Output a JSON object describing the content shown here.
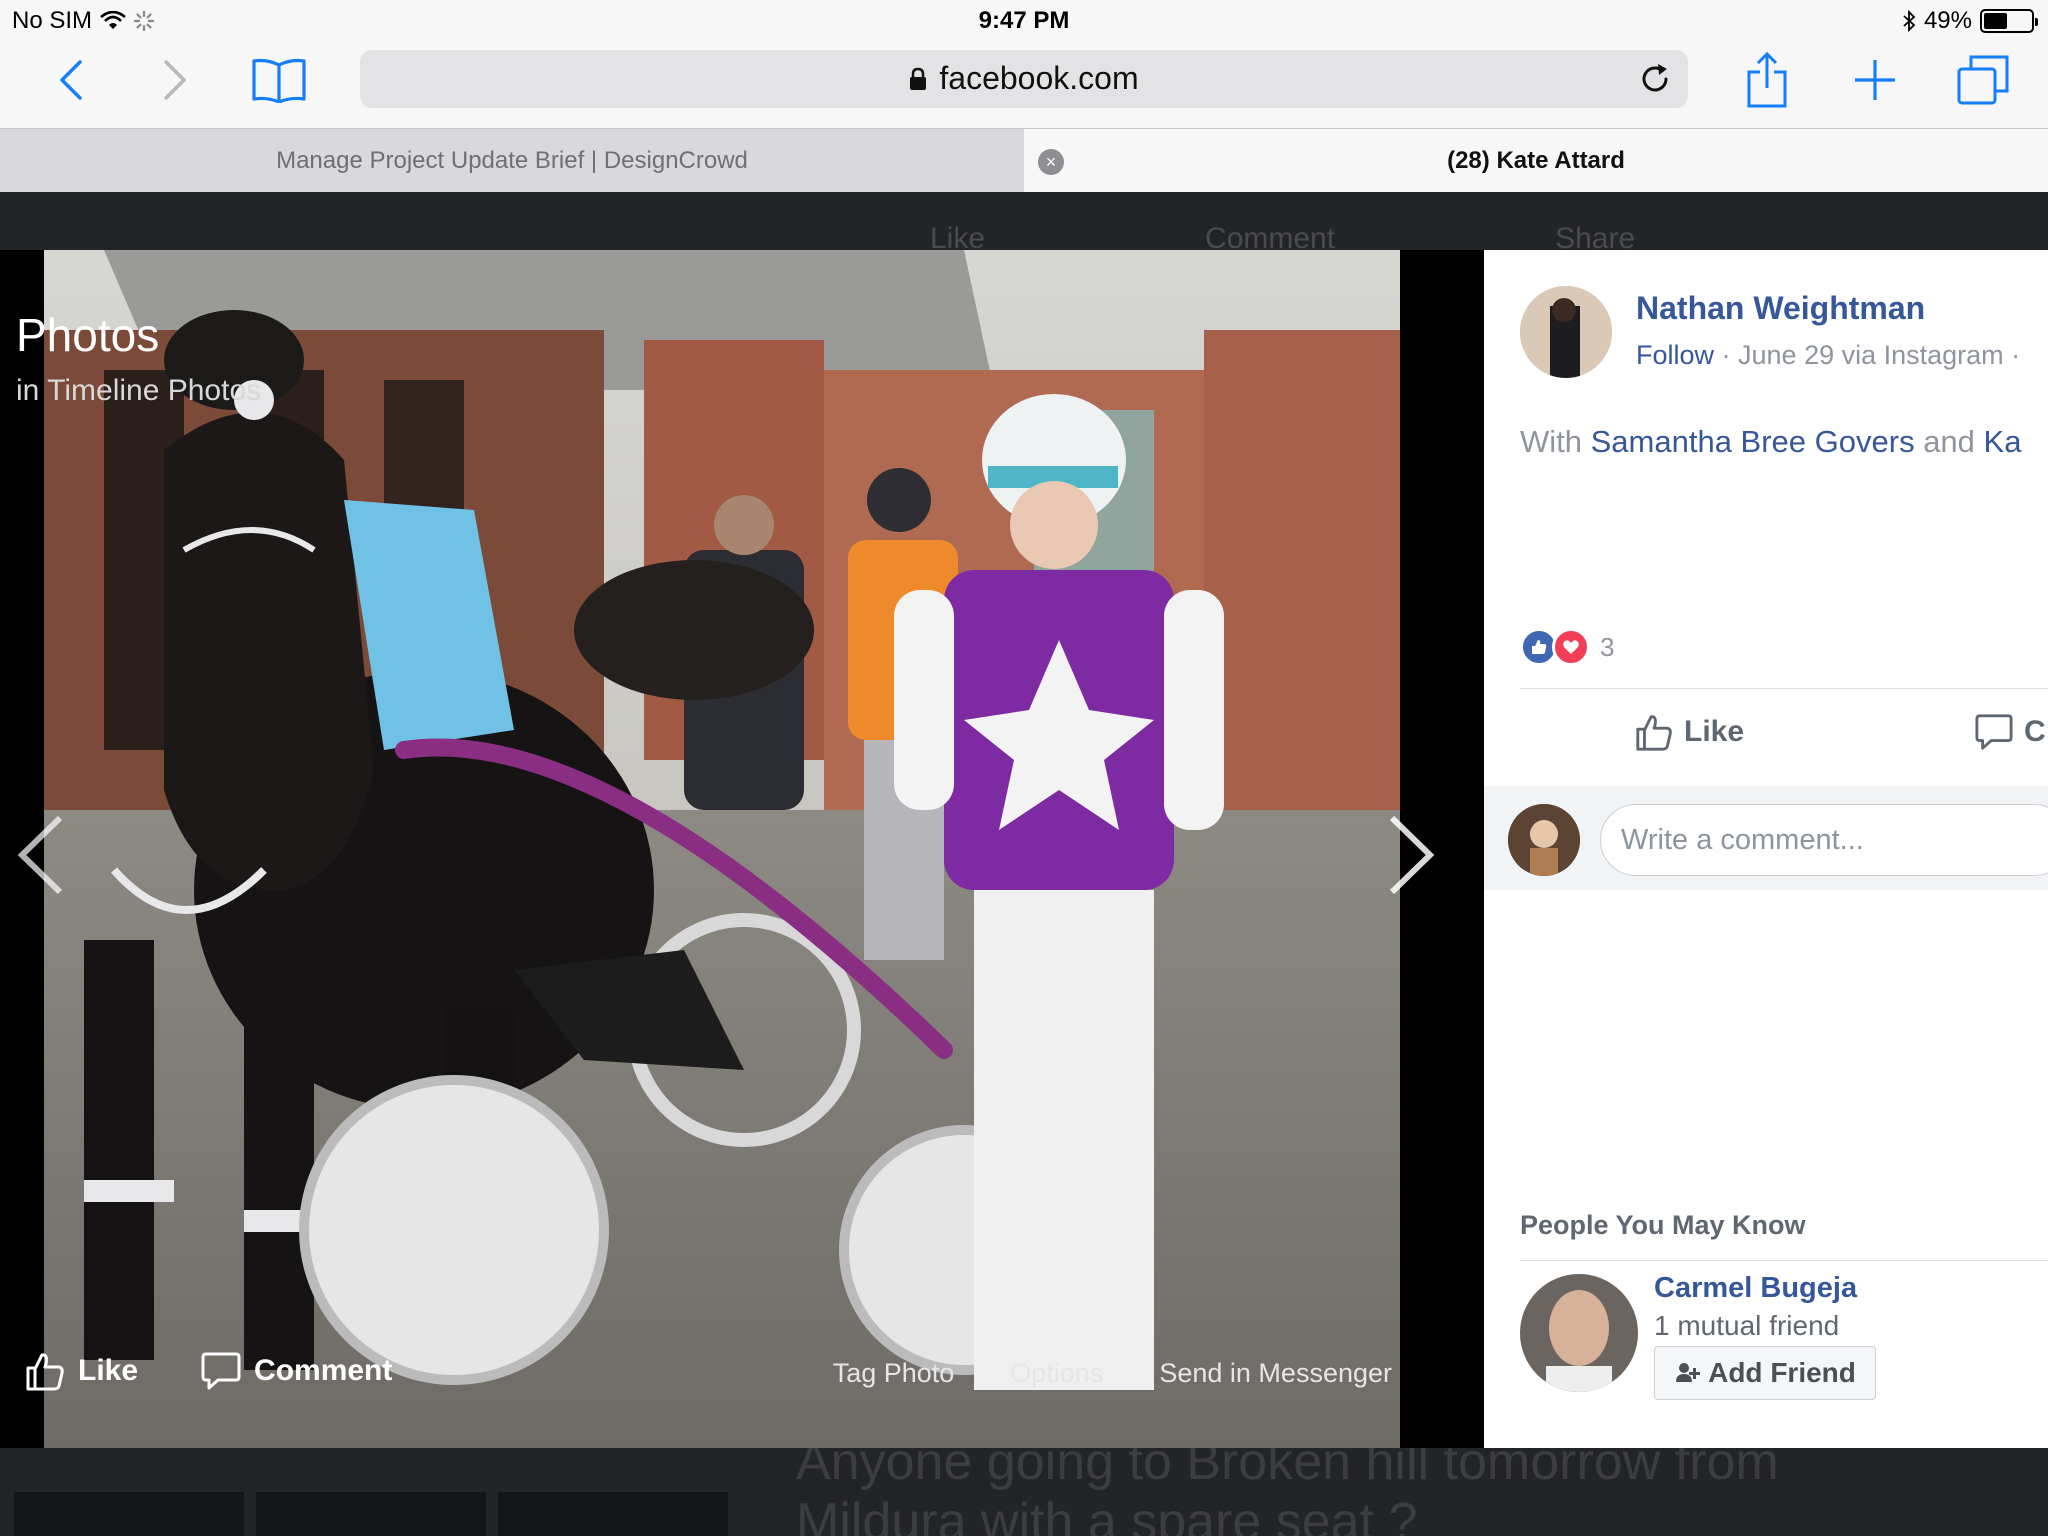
{
  "status_bar": {
    "carrier": "No SIM",
    "time": "9:47 PM",
    "battery_percent": "49%",
    "battery_level": 0.49,
    "icons": [
      "wifi-icon",
      "activity-spinner-icon",
      "bluetooth-icon",
      "battery-icon"
    ]
  },
  "browser": {
    "url": "facebook.com",
    "icons": [
      "back-icon",
      "forward-icon",
      "bookmarks-icon",
      "lock-icon",
      "reload-icon",
      "share-icon",
      "new-tab-icon",
      "tabs-icon"
    ],
    "tabs": [
      {
        "label": "Manage Project Update Brief | DesignCrowd",
        "active": false
      },
      {
        "label": "(28) Kate Attard",
        "active": true
      }
    ],
    "close_symbol": "×"
  },
  "background_page": {
    "actions": [
      "Like",
      "Comment",
      "Share"
    ],
    "post_text_line1": "Anyone going to Broken hill tomorrow from",
    "post_text_line2": "Mildura with a spare seat ?"
  },
  "viewer": {
    "title": "Photos",
    "subtitle": "in Timeline Photos",
    "like_label": "Like",
    "comment_label": "Comment",
    "links": [
      "Tag Photo",
      "Options",
      "Send in Messenger"
    ]
  },
  "panel": {
    "author": "Nathan Weightman",
    "follow": "Follow",
    "meta": " · June 29 via Instagram ·",
    "with_prefix": "With ",
    "with_name": "Samantha Bree Govers",
    "with_and": " and ",
    "with_name2": "Ka",
    "reaction_count": "3",
    "like_label": "Like",
    "comment_label": "C",
    "comment_placeholder": "Write a comment...",
    "pymk_title": "People You May Know",
    "friend_name": "Carmel Bugeja",
    "friend_mutual": "1 mutual friend",
    "add_friend_label": "Add Friend"
  },
  "colors": {
    "facebook_link": "#365899",
    "ios_blue": "#147efb",
    "love_red": "#f33e58"
  }
}
